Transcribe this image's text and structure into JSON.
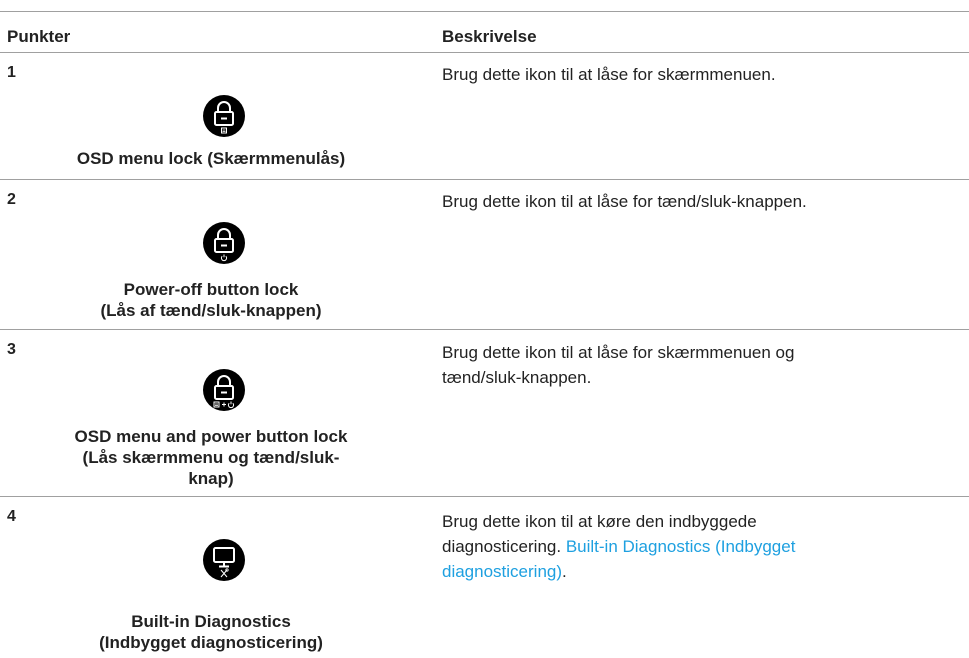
{
  "table": {
    "col_items": "Punkter",
    "col_desc": "Beskrivelse",
    "rows": [
      {
        "number": "1",
        "icon": "osd-lock-icon",
        "label": "OSD menu lock (Skærmmenulås)",
        "desc": "Brug dette ikon til at låse for skærmmenuen."
      },
      {
        "number": "2",
        "icon": "power-lock-icon",
        "label_line1": "Power-off button lock",
        "label_line2": "(Lås af tænd/sluk-knappen)",
        "desc": "Brug dette ikon til at låse for tænd/sluk-knappen."
      },
      {
        "number": "3",
        "icon": "osd-power-lock-icon",
        "label_line1": "OSD menu and power button lock",
        "label_line2": "(Lås skærmmenu og tænd/sluk-",
        "label_line3": "knap)",
        "desc_line1": "Brug dette ikon til at låse for skærmmenuen og",
        "desc_line2": "tænd/sluk-knappen."
      },
      {
        "number": "4",
        "icon": "diagnostics-icon",
        "label_line1": "Built-in Diagnostics",
        "label_line2": "(Indbygget diagnosticering)",
        "desc_line1": "Brug dette ikon til at køre den indbyggede",
        "desc_line2_text": "diagnosticering.",
        "desc_link_part1": "Built-in Diagnostics (Indbygget",
        "desc_link_part2": "diagnosticering)",
        "desc_end": "."
      }
    ]
  },
  "colors": {
    "link": "#1ea0e0",
    "icon_bg": "#000000",
    "rule": "#a0a0a0"
  }
}
